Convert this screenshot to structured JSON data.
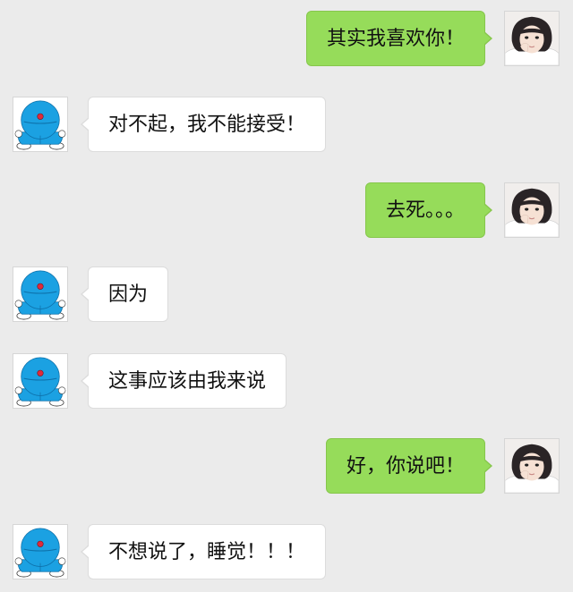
{
  "chat": {
    "messages": [
      {
        "side": "right",
        "avatar": "girl-photo-avatar",
        "text": "其实我喜欢你！"
      },
      {
        "side": "left",
        "avatar": "doraemon-avatar",
        "text": "对不起，我不能接受！"
      },
      {
        "side": "right",
        "avatar": "girl-photo-avatar",
        "text": "去死。。。"
      },
      {
        "side": "left",
        "avatar": "doraemon-avatar",
        "text": "因为"
      },
      {
        "side": "left",
        "avatar": "doraemon-avatar",
        "text": "这事应该由我来说"
      },
      {
        "side": "right",
        "avatar": "girl-photo-avatar",
        "text": "好，你说吧！"
      },
      {
        "side": "left",
        "avatar": "doraemon-avatar",
        "text": "不想说了，睡觉！！！"
      }
    ]
  },
  "colors": {
    "background": "#ebebeb",
    "sent_bubble": "#96dc5a",
    "received_bubble": "#ffffff"
  }
}
